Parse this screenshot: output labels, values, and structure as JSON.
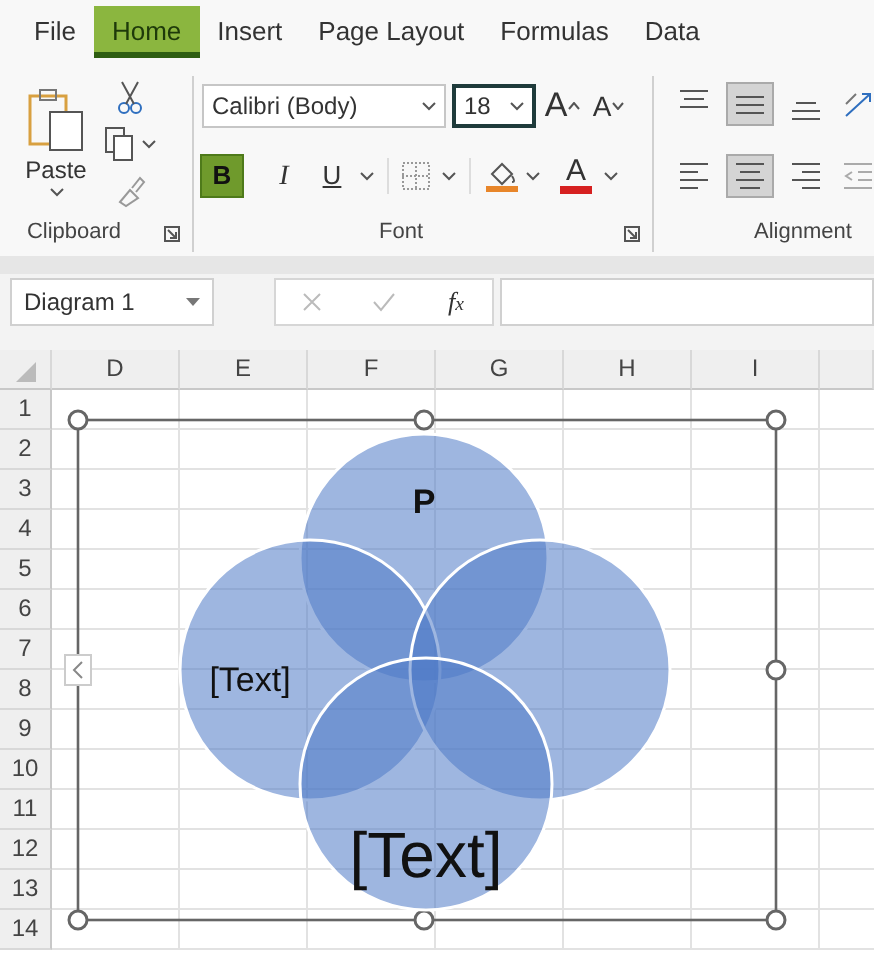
{
  "menu_tabs": [
    {
      "label": "File",
      "selected": false
    },
    {
      "label": "Home",
      "selected": true
    },
    {
      "label": "Insert",
      "selected": false
    },
    {
      "label": "Page Layout",
      "selected": false
    },
    {
      "label": "Formulas",
      "selected": false
    },
    {
      "label": "Data",
      "selected": false
    }
  ],
  "clipboard": {
    "paste_label": "Paste",
    "group_label": "Clipboard"
  },
  "font": {
    "font_name": "Calibri (Body)",
    "font_size": "18",
    "grow_label": "A",
    "shrink_label": "A",
    "bold_label": "B",
    "italic_label": "I",
    "underline_label": "U",
    "color_label": "A",
    "bold": true,
    "italic": false,
    "underline": false,
    "group_label": "Font"
  },
  "alignment": {
    "group_label": "Alignment",
    "vertical": [
      {
        "selected": false
      },
      {
        "selected": true
      },
      {
        "selected": false
      }
    ],
    "horizontal": [
      {
        "selected": false
      },
      {
        "selected": true
      },
      {
        "selected": false
      }
    ]
  },
  "formula_bar": {
    "name_box": "Diagram 1",
    "function_label": "f$_{x}$"
  },
  "columns": [
    "D",
    "E",
    "F",
    "G",
    "H",
    "I"
  ],
  "rows": [
    "1",
    "2",
    "3",
    "4",
    "5",
    "6",
    "7",
    "8",
    "9",
    "10",
    "11",
    "12",
    "13",
    "14"
  ],
  "diagram": {
    "labels": [
      {
        "text": "P",
        "bold": true
      },
      {
        "text": "[Text]",
        "bold": false
      },
      {
        "text": "[Text]",
        "bold": false
      }
    ]
  }
}
